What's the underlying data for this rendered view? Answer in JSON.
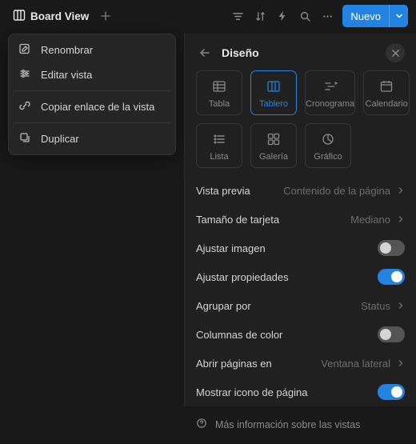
{
  "topbar": {
    "view_label": "Board View",
    "new_label": "Nuevo"
  },
  "context_menu": {
    "rename": "Renombrar",
    "edit_view": "Editar vista",
    "copy_link": "Copiar enlace de la vista",
    "duplicate": "Duplicar"
  },
  "panel": {
    "title": "Diseño",
    "layouts": {
      "table": "Tabla",
      "board": "Tablero",
      "timeline": "Cronograma",
      "calendar": "Calendario",
      "list": "Lista",
      "gallery": "Galería",
      "chart": "Gráfico"
    },
    "options": {
      "preview_label": "Vista previa",
      "preview_value": "Contenido de la página",
      "card_size_label": "Tamaño de tarjeta",
      "card_size_value": "Mediano",
      "fit_image_label": "Ajustar imagen",
      "fit_image_on": false,
      "fit_props_label": "Ajustar propiedades",
      "fit_props_on": true,
      "group_by_label": "Agrupar por",
      "group_by_value": "Status",
      "color_cols_label": "Columnas de color",
      "color_cols_on": false,
      "open_pages_label": "Abrir páginas en",
      "open_pages_value": "Ventana lateral",
      "show_icon_label": "Mostrar icono de página",
      "show_icon_on": true,
      "learn_more": "Más información sobre las vistas"
    }
  }
}
